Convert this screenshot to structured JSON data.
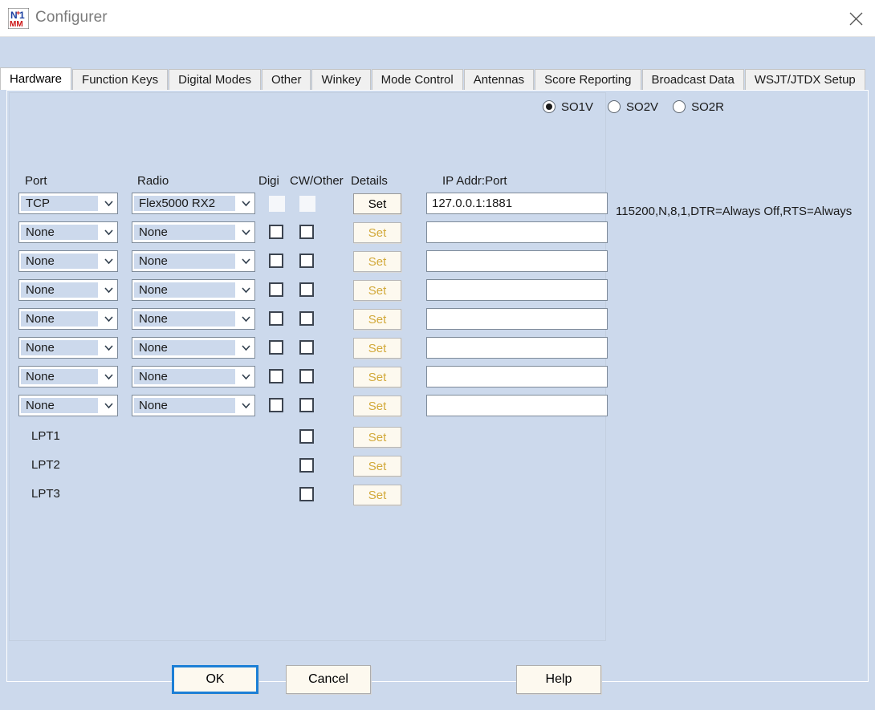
{
  "window": {
    "title": "Configurer",
    "icon": "n1mm-logo-icon",
    "close_label": "✕"
  },
  "tabs": [
    {
      "label": "Hardware",
      "active": true
    },
    {
      "label": "Function Keys",
      "active": false
    },
    {
      "label": "Digital Modes",
      "active": false
    },
    {
      "label": "Other",
      "active": false
    },
    {
      "label": "Winkey",
      "active": false
    },
    {
      "label": "Mode Control",
      "active": false
    },
    {
      "label": "Antennas",
      "active": false
    },
    {
      "label": "Score Reporting",
      "active": false
    },
    {
      "label": "Broadcast Data",
      "active": false
    },
    {
      "label": "WSJT/JTDX Setup",
      "active": false
    }
  ],
  "operating_mode": {
    "options": [
      {
        "label": "SO1V",
        "checked": true
      },
      {
        "label": "SO2V",
        "checked": false
      },
      {
        "label": "SO2R",
        "checked": false
      }
    ]
  },
  "columns": {
    "port": "Port",
    "radio": "Radio",
    "digi": "Digi",
    "cw_other": "CW/Other",
    "details": "Details",
    "ip_addr_port": "IP Addr:Port"
  },
  "set_button_label": "Set",
  "port_settings_summary": "115200,N,8,1,DTR=Always Off,RTS=Always",
  "rows": [
    {
      "port": "TCP",
      "radio": "Flex5000 RX2",
      "digi": false,
      "cw": false,
      "set_enabled": true,
      "ip": "127.0.0.1:1881"
    },
    {
      "port": "None",
      "radio": "None",
      "digi": false,
      "cw": false,
      "set_enabled": false,
      "ip": ""
    },
    {
      "port": "None",
      "radio": "None",
      "digi": false,
      "cw": false,
      "set_enabled": false,
      "ip": ""
    },
    {
      "port": "None",
      "radio": "None",
      "digi": false,
      "cw": false,
      "set_enabled": false,
      "ip": ""
    },
    {
      "port": "None",
      "radio": "None",
      "digi": false,
      "cw": false,
      "set_enabled": false,
      "ip": ""
    },
    {
      "port": "None",
      "radio": "None",
      "digi": false,
      "cw": false,
      "set_enabled": false,
      "ip": ""
    },
    {
      "port": "None",
      "radio": "None",
      "digi": false,
      "cw": false,
      "set_enabled": false,
      "ip": ""
    },
    {
      "port": "None",
      "radio": "None",
      "digi": false,
      "cw": false,
      "set_enabled": false,
      "ip": ""
    }
  ],
  "lpt_rows": [
    {
      "label": "LPT1",
      "cw": false
    },
    {
      "label": "LPT2",
      "cw": false
    },
    {
      "label": "LPT3",
      "cw": false
    }
  ],
  "footer": {
    "ok": "OK",
    "cancel": "Cancel",
    "help": "Help"
  },
  "colors": {
    "dialog_background": "#ccd9ec",
    "button_face": "#fdf9ef",
    "focus_border": "#1c7fd6",
    "disabled_text": "#d2a93a",
    "title_text": "#7a7a7a"
  }
}
